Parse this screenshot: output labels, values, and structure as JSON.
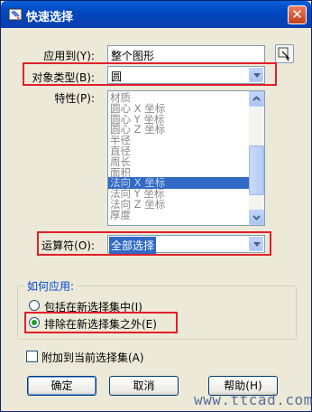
{
  "window": {
    "title": "快速选择",
    "close_label": "✕"
  },
  "fields": {
    "apply_to": {
      "label": "应用到(Y):",
      "value": "整个图形"
    },
    "object_type": {
      "label": "对象类型(B):",
      "value": "圆"
    },
    "properties": {
      "label": "特性(P):"
    },
    "operator": {
      "label": "运算符(O):",
      "value": "全部选择"
    }
  },
  "properties_list": [
    {
      "text": "材质",
      "selected": false
    },
    {
      "text": "圆心 X 坐标",
      "selected": false
    },
    {
      "text": "圆心 Y 坐标",
      "selected": false
    },
    {
      "text": "圆心 Z 坐标",
      "selected": false
    },
    {
      "text": "半径",
      "selected": false
    },
    {
      "text": "直径",
      "selected": false
    },
    {
      "text": "周长",
      "selected": false
    },
    {
      "text": "面积",
      "selected": false
    },
    {
      "text": "法向 X 坐标",
      "selected": true
    },
    {
      "text": "法向 Y 坐标",
      "selected": false
    },
    {
      "text": "法向 Z 坐标",
      "selected": false
    },
    {
      "text": "厚度",
      "selected": false
    }
  ],
  "apply_group": {
    "title": "如何应用:",
    "include_label": "包括在新选择集中(I)",
    "exclude_label": "排除在新选择集之外(E)",
    "selected": "exclude"
  },
  "append_label": "附加到当前选择集(A)",
  "buttons": {
    "ok": "确定",
    "cancel": "取消",
    "help": "帮助(H)"
  },
  "watermark": "www.ttcad.com",
  "colors": {
    "highlight": "#e0202a",
    "selection": "#316ac5",
    "title_bar": "#0a5fd8"
  }
}
